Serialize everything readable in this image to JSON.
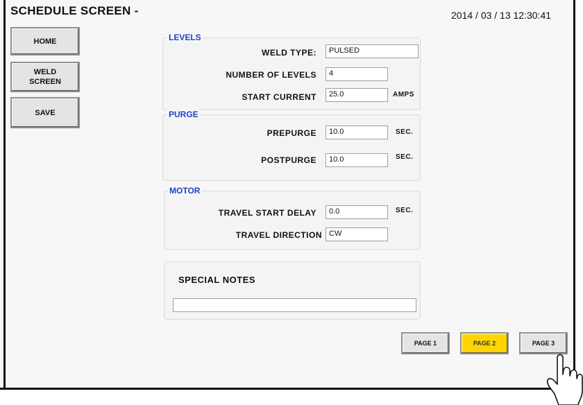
{
  "header": {
    "title": "SCHEDULE SCREEN -",
    "datetime": "2014 / 03 / 13   12:30:41"
  },
  "nav": {
    "home": "HOME",
    "weld_screen_line1": "WELD",
    "weld_screen_line2": "SCREEN",
    "save": "SAVE"
  },
  "levels": {
    "title": "LEVELS",
    "weld_type_label": "WELD TYPE:",
    "weld_type_value": "PULSED",
    "num_levels_label": "NUMBER OF LEVELS",
    "num_levels_value": "4",
    "start_current_label": "START CURRENT",
    "start_current_value": "25.0",
    "start_current_unit": "AMPS"
  },
  "purge": {
    "title": "PURGE",
    "prepurge_label": "PREPURGE",
    "prepurge_value": "10.0",
    "prepurge_unit": "SEC.",
    "postpurge_label": "POSTPURGE",
    "postpurge_value": "10.0",
    "postpurge_unit": "SEC."
  },
  "motor": {
    "title": "MOTOR",
    "travel_delay_label": "TRAVEL START DELAY",
    "travel_delay_value": "0.0",
    "travel_delay_unit": "SEC.",
    "travel_dir_label": "TRAVEL DIRECTION",
    "travel_dir_value": "CW"
  },
  "notes": {
    "label": "SPECIAL NOTES",
    "value": ""
  },
  "pages": {
    "page1": "PAGE 1",
    "page2": "PAGE 2",
    "page3": "PAGE 3",
    "active": "page2",
    "active_color": "#ffd400"
  }
}
